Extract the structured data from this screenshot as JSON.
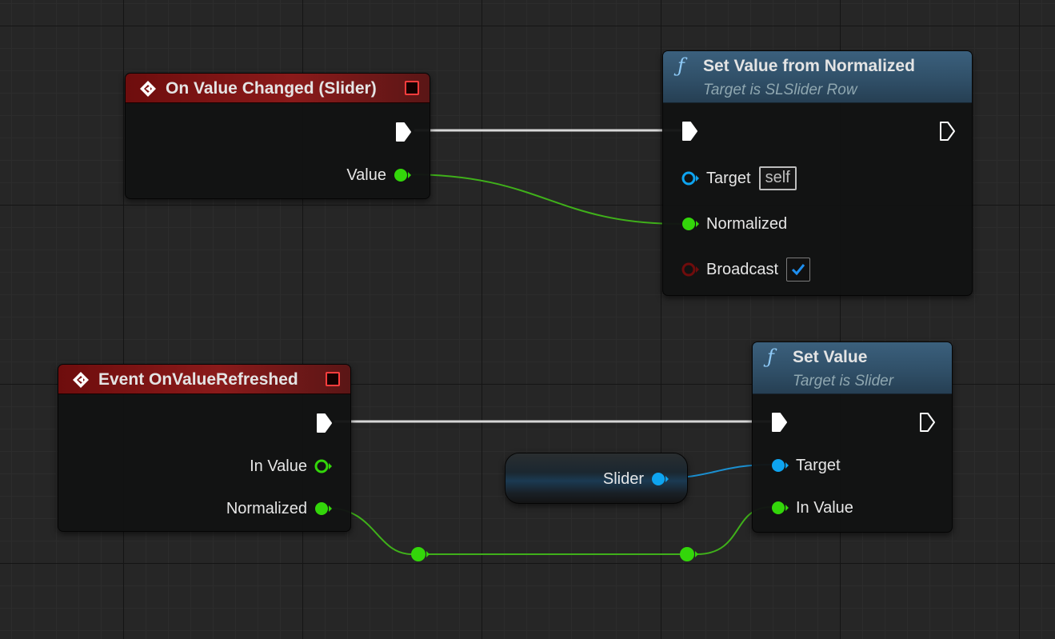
{
  "colors": {
    "exec": "#ffffff",
    "float_pin": "#33d60a",
    "object_pin": "#0ea4f0",
    "bool_pin": "#6f0c0c",
    "event_header": "#8a1a1a",
    "function_header": "#3b607d",
    "function_icon": "#8ecaf7"
  },
  "icons": {
    "event_node": "event-diamond-icon",
    "function_node": "function-f-icon",
    "delegate": "delegate-stop-icon"
  },
  "nodes": {
    "on_value_changed": {
      "title": "On Value Changed (Slider)",
      "pins": {
        "value": "Value"
      }
    },
    "set_value_from_normalized": {
      "title": "Set Value from Normalized",
      "subtitle": "Target is SLSlider Row",
      "pins": {
        "target": "Target",
        "target_default": "self",
        "normalized": "Normalized",
        "broadcast": "Broadcast"
      },
      "broadcast_checked": true
    },
    "event_on_value_refreshed": {
      "title": "Event OnValueRefreshed",
      "pins": {
        "in_value": "In Value",
        "normalized": "Normalized"
      }
    },
    "slider_variable": {
      "label": "Slider"
    },
    "set_value": {
      "title": "Set Value",
      "subtitle": "Target is Slider",
      "pins": {
        "target": "Target",
        "in_value": "In Value"
      }
    }
  }
}
